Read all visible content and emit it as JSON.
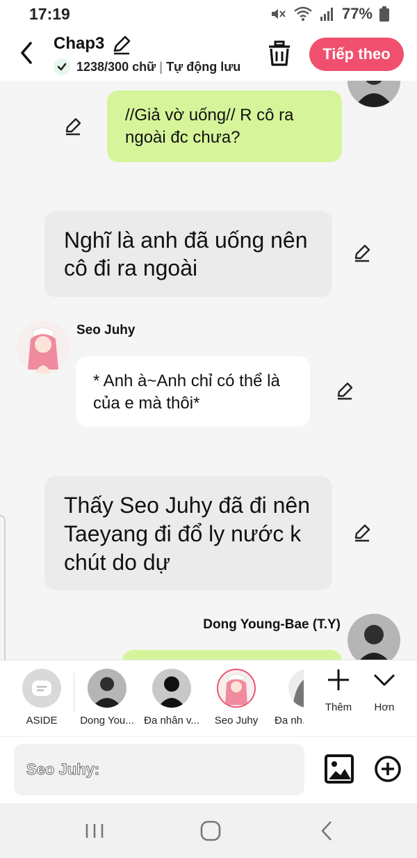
{
  "status_bar": {
    "time": "17:19",
    "battery": "77%"
  },
  "header": {
    "title": "Chap3",
    "word_count": "1238/300 chữ",
    "autosave": "Tự động lưu",
    "next_button": "Tiếp theo"
  },
  "messages": [
    {
      "kind": "right",
      "text": "//Giả vờ uống// R cô ra ngoài đc chưa?"
    },
    {
      "kind": "narration",
      "text": "Nghĩ là anh đã uống nên cô đi ra ngoài"
    },
    {
      "kind": "left",
      "speaker": "Seo Juhy",
      "text": "* Anh à~Anh chỉ có thể là của e mà thôi*"
    },
    {
      "kind": "narration",
      "text": "Thấy Seo Juhy đã đi nên Taeyang đi đổ ly nước k chút do dự"
    },
    {
      "kind": "right",
      "speaker": "Dong Young-Bae (T.Y)"
    }
  ],
  "characters": [
    {
      "name": "ASIDE"
    },
    {
      "name": "Dong You..."
    },
    {
      "name": "Đa nhân v..."
    },
    {
      "name": "Seo Juhy"
    },
    {
      "name": "Đa nh..."
    }
  ],
  "tools": {
    "add": "Thêm",
    "more": "Hơn"
  },
  "input": {
    "label": "Seo Juhy:"
  },
  "colors": {
    "accent": "#f0506e",
    "right_bubble": "#d6f59b",
    "narration_bubble": "#ebebeb",
    "left_bubble": "#ffffff"
  }
}
